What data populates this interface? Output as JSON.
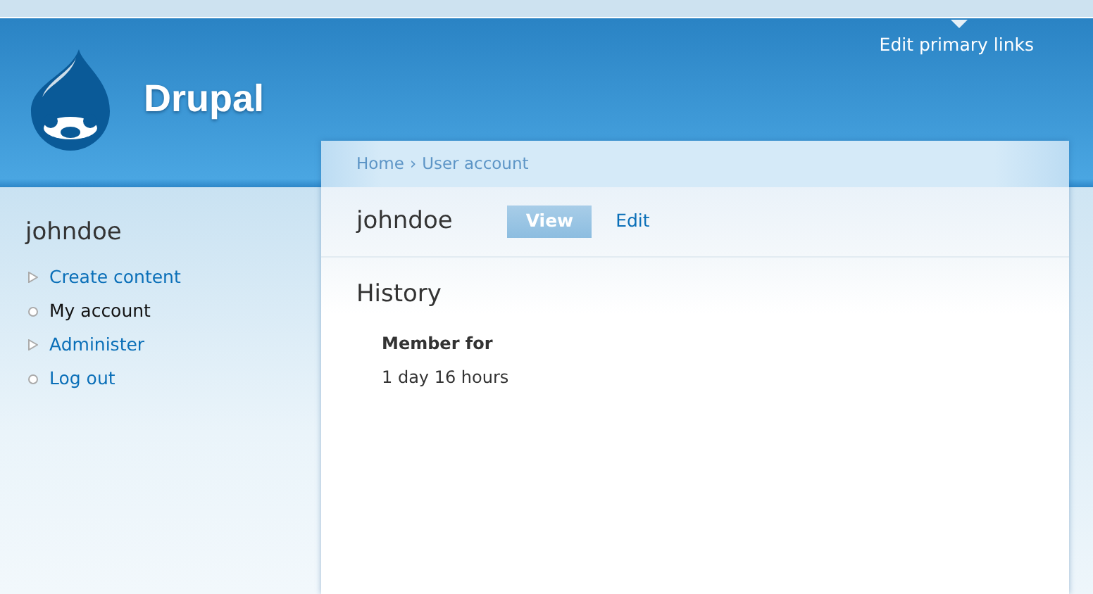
{
  "header": {
    "site_name": "Drupal",
    "primary_links_edit": "Edit primary links"
  },
  "sidebar": {
    "title": "johndoe",
    "items": [
      {
        "label": "Create content",
        "kind": "collapsed",
        "selected": false
      },
      {
        "label": "My account",
        "kind": "leaf",
        "selected": true
      },
      {
        "label": "Administer",
        "kind": "collapsed",
        "selected": false
      },
      {
        "label": "Log out",
        "kind": "leaf",
        "selected": false
      }
    ]
  },
  "breadcrumb": [
    {
      "label": "Home"
    },
    {
      "label": "User account"
    }
  ],
  "breadcrumb_separator": "›",
  "page": {
    "title": "johndoe",
    "tabs": [
      {
        "label": "View",
        "selected": true
      },
      {
        "label": "Edit",
        "selected": false
      }
    ],
    "section_title": "History",
    "fields": [
      {
        "label": "Member for",
        "value": "1 day 16 hours"
      }
    ]
  }
}
